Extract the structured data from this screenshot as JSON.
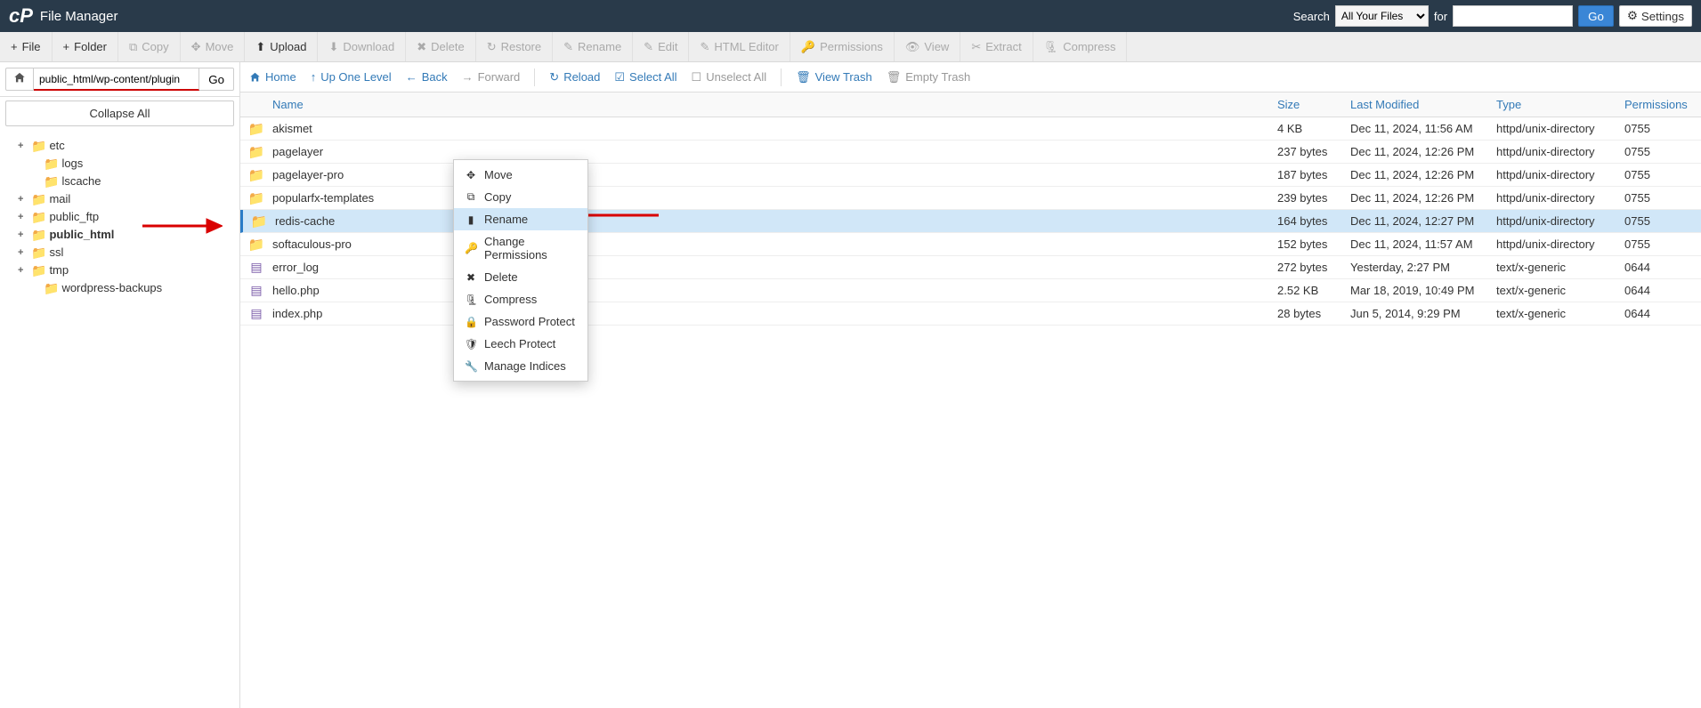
{
  "header": {
    "title": "File Manager",
    "search_label": "Search",
    "search_scope": "All Your Files",
    "for_label": "for",
    "go_label": "Go",
    "settings_label": "Settings"
  },
  "toolbar": [
    {
      "icon": "+",
      "label": "File",
      "enabled": true
    },
    {
      "icon": "+",
      "label": "Folder",
      "enabled": true
    },
    {
      "icon": "⧉",
      "label": "Copy",
      "enabled": false
    },
    {
      "icon": "✥",
      "label": "Move",
      "enabled": false
    },
    {
      "icon": "⬆",
      "label": "Upload",
      "enabled": true
    },
    {
      "icon": "⬇",
      "label": "Download",
      "enabled": false
    },
    {
      "icon": "✖",
      "label": "Delete",
      "enabled": false
    },
    {
      "icon": "↻",
      "label": "Restore",
      "enabled": false
    },
    {
      "icon": "✎",
      "label": "Rename",
      "enabled": false
    },
    {
      "icon": "✎",
      "label": "Edit",
      "enabled": false
    },
    {
      "icon": "✎",
      "label": "HTML Editor",
      "enabled": false
    },
    {
      "icon": "🔑",
      "label": "Permissions",
      "enabled": false
    },
    {
      "icon": "👁",
      "label": "View",
      "enabled": false
    },
    {
      "icon": "✂",
      "label": "Extract",
      "enabled": false
    },
    {
      "icon": "🗜",
      "label": "Compress",
      "enabled": false
    }
  ],
  "sidebar": {
    "path": "public_html/wp-content/plugin",
    "go_label": "Go",
    "collapse_label": "Collapse All",
    "tree": [
      {
        "label": "etc",
        "toggle": "+",
        "child": false,
        "bold": false
      },
      {
        "label": "logs",
        "toggle": "",
        "child": true,
        "bold": false
      },
      {
        "label": "lscache",
        "toggle": "",
        "child": true,
        "bold": false
      },
      {
        "label": "mail",
        "toggle": "+",
        "child": false,
        "bold": false
      },
      {
        "label": "public_ftp",
        "toggle": "+",
        "child": false,
        "bold": false
      },
      {
        "label": "public_html",
        "toggle": "+",
        "child": false,
        "bold": true
      },
      {
        "label": "ssl",
        "toggle": "+",
        "child": false,
        "bold": false
      },
      {
        "label": "tmp",
        "toggle": "+",
        "child": false,
        "bold": false
      },
      {
        "label": "wordpress-backups",
        "toggle": "",
        "child": true,
        "bold": false
      }
    ]
  },
  "actionbar": {
    "home": "Home",
    "up": "Up One Level",
    "back": "Back",
    "forward": "Forward",
    "reload": "Reload",
    "select_all": "Select All",
    "unselect_all": "Unselect All",
    "view_trash": "View Trash",
    "empty_trash": "Empty Trash"
  },
  "columns": {
    "name": "Name",
    "size": "Size",
    "modified": "Last Modified",
    "type": "Type",
    "permissions": "Permissions"
  },
  "rows": [
    {
      "kind": "folder",
      "name": "akismet",
      "size": "4 KB",
      "modified": "Dec 11, 2024, 11:56 AM",
      "type": "httpd/unix-directory",
      "perms": "0755",
      "selected": false
    },
    {
      "kind": "folder",
      "name": "pagelayer",
      "size": "237 bytes",
      "modified": "Dec 11, 2024, 12:26 PM",
      "type": "httpd/unix-directory",
      "perms": "0755",
      "selected": false
    },
    {
      "kind": "folder",
      "name": "pagelayer-pro",
      "size": "187 bytes",
      "modified": "Dec 11, 2024, 12:26 PM",
      "type": "httpd/unix-directory",
      "perms": "0755",
      "selected": false
    },
    {
      "kind": "folder",
      "name": "popularfx-templates",
      "size": "239 bytes",
      "modified": "Dec 11, 2024, 12:26 PM",
      "type": "httpd/unix-directory",
      "perms": "0755",
      "selected": false
    },
    {
      "kind": "folder",
      "name": "redis-cache",
      "size": "164 bytes",
      "modified": "Dec 11, 2024, 12:27 PM",
      "type": "httpd/unix-directory",
      "perms": "0755",
      "selected": true
    },
    {
      "kind": "folder",
      "name": "softaculous-pro",
      "size": "152 bytes",
      "modified": "Dec 11, 2024, 11:57 AM",
      "type": "httpd/unix-directory",
      "perms": "0755",
      "selected": false
    },
    {
      "kind": "file",
      "name": "error_log",
      "size": "272 bytes",
      "modified": "Yesterday, 2:27 PM",
      "type": "text/x-generic",
      "perms": "0644",
      "selected": false
    },
    {
      "kind": "file",
      "name": "hello.php",
      "size": "2.52 KB",
      "modified": "Mar 18, 2019, 10:49 PM",
      "type": "text/x-generic",
      "perms": "0644",
      "selected": false
    },
    {
      "kind": "file",
      "name": "index.php",
      "size": "28 bytes",
      "modified": "Jun 5, 2014, 9:29 PM",
      "type": "text/x-generic",
      "perms": "0644",
      "selected": false
    }
  ],
  "context_menu": [
    {
      "icon": "✥",
      "label": "Move"
    },
    {
      "icon": "⧉",
      "label": "Copy"
    },
    {
      "icon": "▮",
      "label": "Rename",
      "highlighted": true
    },
    {
      "icon": "🔑",
      "label": "Change Permissions"
    },
    {
      "icon": "✖",
      "label": "Delete"
    },
    {
      "icon": "🗜",
      "label": "Compress"
    },
    {
      "icon": "🔒",
      "label": "Password Protect"
    },
    {
      "icon": "🛡",
      "label": "Leech Protect"
    },
    {
      "icon": "🔧",
      "label": "Manage Indices"
    }
  ]
}
